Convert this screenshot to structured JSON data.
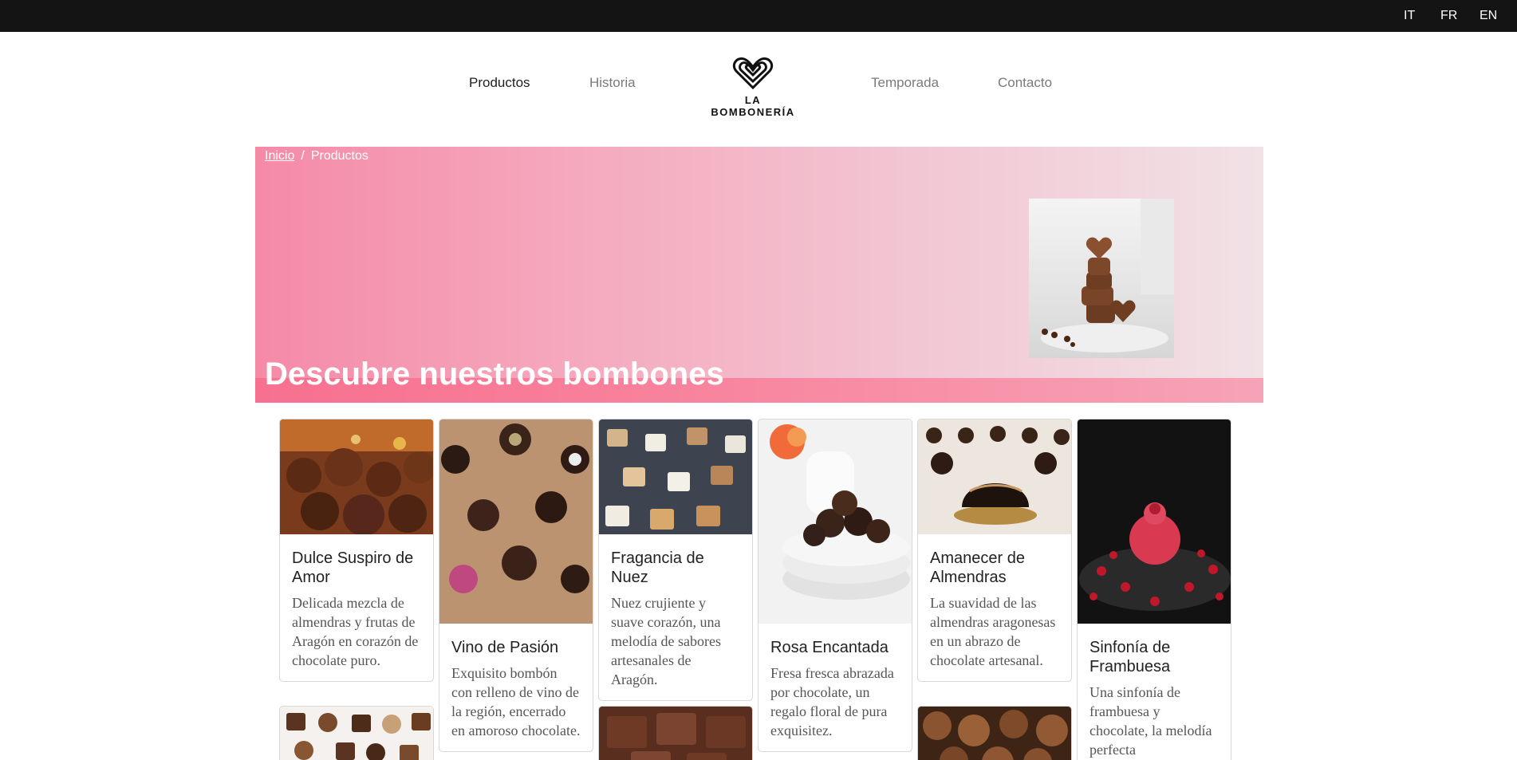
{
  "languages": [
    "IT",
    "FR",
    "EN"
  ],
  "nav": {
    "items": [
      "Productos",
      "Historia",
      "Temporada",
      "Contacto"
    ],
    "brand": "LA BOMBONERÍA"
  },
  "breadcrumb": {
    "home": "Inicio",
    "separator": "/",
    "current": "Productos"
  },
  "hero": {
    "title": "Descubre nuestros bombones"
  },
  "products": [
    {
      "name": "Dulce Suspiro de Amor",
      "description": "Delicada mezcla de almendras y frutas de Aragón en corazón de chocolate puro."
    },
    {
      "name": "Vino de Pasión",
      "description": "Exquisito bombón con relleno de vino de la región, encerrado en amoroso chocolate."
    },
    {
      "name": "Fragancia de Nuez",
      "description": "Nuez crujiente y suave corazón, una melodía de sabores artesanales de Aragón."
    },
    {
      "name": "Rosa Encantada",
      "description": "Fresa fresca abrazada por chocolate, un regalo floral de pura exquisitez."
    },
    {
      "name": "Amanecer de Almendras",
      "description": "La suavidad de las almendras aragonesas en un abrazo de chocolate artesanal."
    },
    {
      "name": "Sinfonía de Frambuesa",
      "description": "Una sinfonía de frambuesa y chocolate, la melodía perfecta"
    }
  ],
  "colors": {
    "topbar": "#141414",
    "hero_start": "#f58aa7",
    "hero_end": "#f1e2e6",
    "hero_band": "#f7708f"
  }
}
